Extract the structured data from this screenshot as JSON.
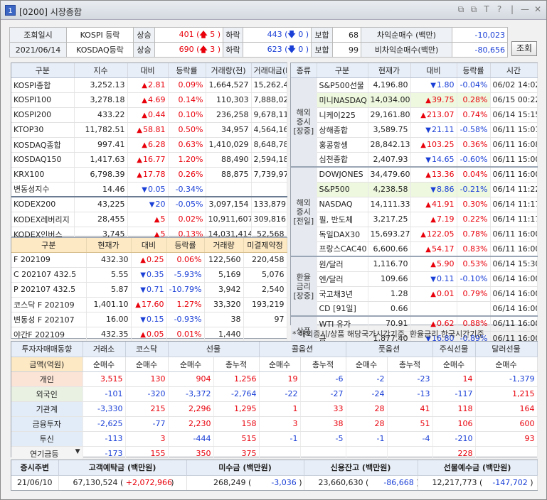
{
  "window": {
    "num": "1",
    "title": "[0200] 시장종합",
    "controls": [
      "⧉",
      "⧉",
      "T",
      "?",
      "|",
      "—",
      "✕"
    ]
  },
  "top": {
    "label_date": "조회일시",
    "date": "2021/06/14",
    "rows": [
      {
        "name": "KOSPI 등락",
        "rise_label": "상승",
        "rise": "401",
        "up_count": "5",
        "fall_label": "하락",
        "fall": "443",
        "down_count": "0",
        "flat_label": "보합",
        "flat": "68"
      },
      {
        "name": "KOSDAQ등락",
        "rise_label": "상승",
        "rise": "690",
        "up_count": "3",
        "fall_label": "하락",
        "fall": "623",
        "down_count": "0",
        "flat_label": "보합",
        "flat": "99"
      }
    ],
    "arb": [
      {
        "label": "차익순매수 (백만)",
        "value": "-10,023"
      },
      {
        "label": "비차익순매수(백만)",
        "value": "-80,656"
      }
    ],
    "query_btn": "조회"
  },
  "idx": {
    "headers": [
      "구분",
      "지수",
      "대비",
      "등락률",
      "거래량(천)",
      "거래대금(M)"
    ],
    "rows": [
      [
        "KOSPI종합",
        "3,252.13",
        "up",
        "2.81",
        "0.09%",
        "1,664,527",
        "15,262,485"
      ],
      [
        "KOSPI100",
        "3,278.18",
        "up",
        "4.69",
        "0.14%",
        "110,303",
        "7,888,028"
      ],
      [
        "KOSPI200",
        "433.22",
        "up",
        "0.44",
        "0.10%",
        "236,258",
        "9,678,115"
      ],
      [
        "KTOP30",
        "11,782.51",
        "up",
        "58.81",
        "0.50%",
        "34,957",
        "4,564,165"
      ],
      [
        "KOSDAQ종합",
        "997.41",
        "up",
        "6.28",
        "0.63%",
        "1,410,029",
        "8,648,789"
      ],
      [
        "KOSDAQ150",
        "1,417.63",
        "up",
        "16.77",
        "1.20%",
        "88,490",
        "2,594,183"
      ],
      [
        "KRX100",
        "6,798.39",
        "up",
        "17.78",
        "0.26%",
        "88,875",
        "7,739,979"
      ],
      [
        "변동성지수",
        "14.46",
        "dn",
        "0.05",
        "-0.34%",
        "",
        ""
      ]
    ],
    "etf": [
      [
        "KODEX200",
        "43,225",
        "dn",
        "20",
        "-0.05%",
        "3,097,154",
        "133,879"
      ],
      [
        "KODEX레버리지",
        "28,455",
        "up",
        "5",
        "0.02%",
        "10,911,607",
        "309,816"
      ],
      [
        "KODEX인버스",
        "3,745",
        "up",
        "5",
        "0.13%",
        "14,031,414",
        "52,568"
      ]
    ]
  },
  "fut": {
    "headers": [
      "구분",
      "현재가",
      "대비",
      "등락률",
      "거래량",
      "미결제약정"
    ],
    "rows": [
      [
        "F 202109",
        "432.30",
        "up",
        "0.25",
        "0.06%",
        "122,560",
        "220,458"
      ],
      [
        "C 202107 432.5",
        "5.55",
        "dn",
        "0.35",
        "-5.93%",
        "5,169",
        "5,076"
      ],
      [
        "P 202107 432.5",
        "5.87",
        "dn",
        "0.71",
        "-10.79%",
        "3,942",
        "2,540"
      ],
      [
        "코스닥 F 202109",
        "1,401.10",
        "up",
        "17.60",
        "1.27%",
        "33,320",
        "193,219"
      ],
      [
        "변동성 F 202107",
        "16.00",
        "dn",
        "0.15",
        "-0.93%",
        "38",
        "97"
      ],
      [
        "야간F 202109",
        "432.35",
        "up",
        "0.05",
        "0.01%",
        "1,440",
        ""
      ]
    ]
  },
  "glob": {
    "headers": [
      "종류",
      "구분",
      "현재가",
      "대비",
      "등락률",
      "시간"
    ],
    "groups": [
      {
        "cat": "해외\n증시\n[장중]",
        "rows": [
          [
            "S&P500선물",
            "4,196.80",
            "dn",
            "1.80",
            "-0.04%",
            "06/02 14:02",
            false
          ],
          [
            "미니NASDAQ",
            "14,034.00",
            "up",
            "39.75",
            "0.28%",
            "06/15 00:22",
            true
          ],
          [
            "니케이225",
            "29,161.80",
            "up",
            "213.07",
            "0.74%",
            "06/14 15:15",
            false
          ],
          [
            "상해종합",
            "3,589.75",
            "dn",
            "21.11",
            "-0.58%",
            "06/11 15:01",
            false
          ],
          [
            "홍콩항셍",
            "28,842.13",
            "up",
            "103.25",
            "0.36%",
            "06/11 16:08",
            false
          ],
          [
            "심천종합",
            "2,407.93",
            "dn",
            "14.65",
            "-0.60%",
            "06/11 15:00",
            false
          ]
        ]
      },
      {
        "cat": "해외\n증시\n[전일]",
        "rows": [
          [
            "DOWJONES",
            "34,479.60",
            "up",
            "13.36",
            "0.04%",
            "06/11 16:00",
            false
          ],
          [
            "S&P500",
            "4,238.58",
            "dn",
            "8.86",
            "-0.21%",
            "06/14 11:22",
            true
          ],
          [
            "NASDAQ",
            "14,111.33",
            "up",
            "41.91",
            "0.30%",
            "06/14 11:17",
            false
          ],
          [
            "필, 반도체",
            "3,217.25",
            "up",
            "7.19",
            "0.22%",
            "06/14 11:17",
            false
          ],
          [
            "독일DAX30",
            "15,693.27",
            "up",
            "122.05",
            "0.78%",
            "06/11 16:00",
            false
          ],
          [
            "프랑스CAC40",
            "6,600.66",
            "up",
            "54.17",
            "0.83%",
            "06/11 16:00",
            false
          ]
        ]
      },
      {
        "cat": "환율\n금리\n[장중]",
        "rows": [
          [
            "원/달러",
            "1,116.70",
            "up",
            "5.90",
            "0.53%",
            "06/14 15:30",
            false
          ],
          [
            "엔/달러",
            "109.66",
            "dn",
            "0.11",
            "-0.10%",
            "06/14 16:00",
            false
          ],
          [
            "국고채3년",
            "1.28",
            "up",
            "0.01",
            "0.79%",
            "06/14 16:00",
            false
          ],
          [
            "CD [91일]",
            "0.66",
            "",
            "",
            "",
            "06/14 16:00",
            false
          ]
        ]
      },
      {
        "cat": "상품",
        "rows": [
          [
            "WTI 유가",
            "70.91",
            "up",
            "0.62",
            "0.88%",
            "06/11 16:00",
            false
          ],
          [
            "금",
            "1,877.40",
            "dn",
            "16.80",
            "-0.89%",
            "06/11 16:00",
            false
          ]
        ]
      }
    ],
    "note": "* 해외증시/상품 해당국가시간기준, 환율금리 한국시간기준"
  },
  "flow": {
    "h1": [
      "투자자매매동향",
      "거래소",
      "코스닥",
      "선물",
      "콜옵션",
      "풋옵션",
      "주식선물",
      "달러선물"
    ],
    "h2": [
      "금액(억원)",
      "순매수",
      "순매수",
      "순매수",
      "총누적",
      "순매수",
      "총누적",
      "순매수",
      "총누적",
      "순매수",
      "순매수"
    ],
    "rows": [
      [
        "개인",
        "3,515",
        "130",
        "904",
        "1,256",
        "19",
        "-6",
        "-2",
        "-23",
        "14",
        "-1,379"
      ],
      [
        "외국인",
        "-101",
        "-320",
        "-3,372",
        "-2,764",
        "-22",
        "-27",
        "-24",
        "-13",
        "-117",
        "1,215"
      ],
      [
        "기관계",
        "-3,330",
        "215",
        "2,296",
        "1,295",
        "1",
        "33",
        "28",
        "41",
        "118",
        "164"
      ],
      [
        "금융투자",
        "-2,625",
        "-77",
        "2,230",
        "158",
        "3",
        "38",
        "28",
        "51",
        "106",
        "600"
      ],
      [
        "투신",
        "-113",
        "3",
        "-444",
        "515",
        "-1",
        "-5",
        "-1",
        "-4",
        "-210",
        "93"
      ],
      [
        "연기금등",
        "-173",
        "155",
        "350",
        "375",
        "",
        "",
        "",
        "",
        "228",
        ""
      ]
    ]
  },
  "bottom": {
    "headers": [
      "증시주변",
      "고객예탁금 (백만원)",
      "미수금 (백만원)",
      "신용잔고 (백만원)",
      "선물예수금 (백만원)"
    ],
    "date": "21/06/10",
    "deposit": "67,130,524",
    "deposit_chg": "+2,072,966",
    "unpaid": "268,249",
    "unpaid_chg": "-3,036",
    "credit": "23,660,630",
    "credit_chg": "-86,668",
    "fut_dep": "12,217,773",
    "fut_dep_chg": "-147,702"
  }
}
